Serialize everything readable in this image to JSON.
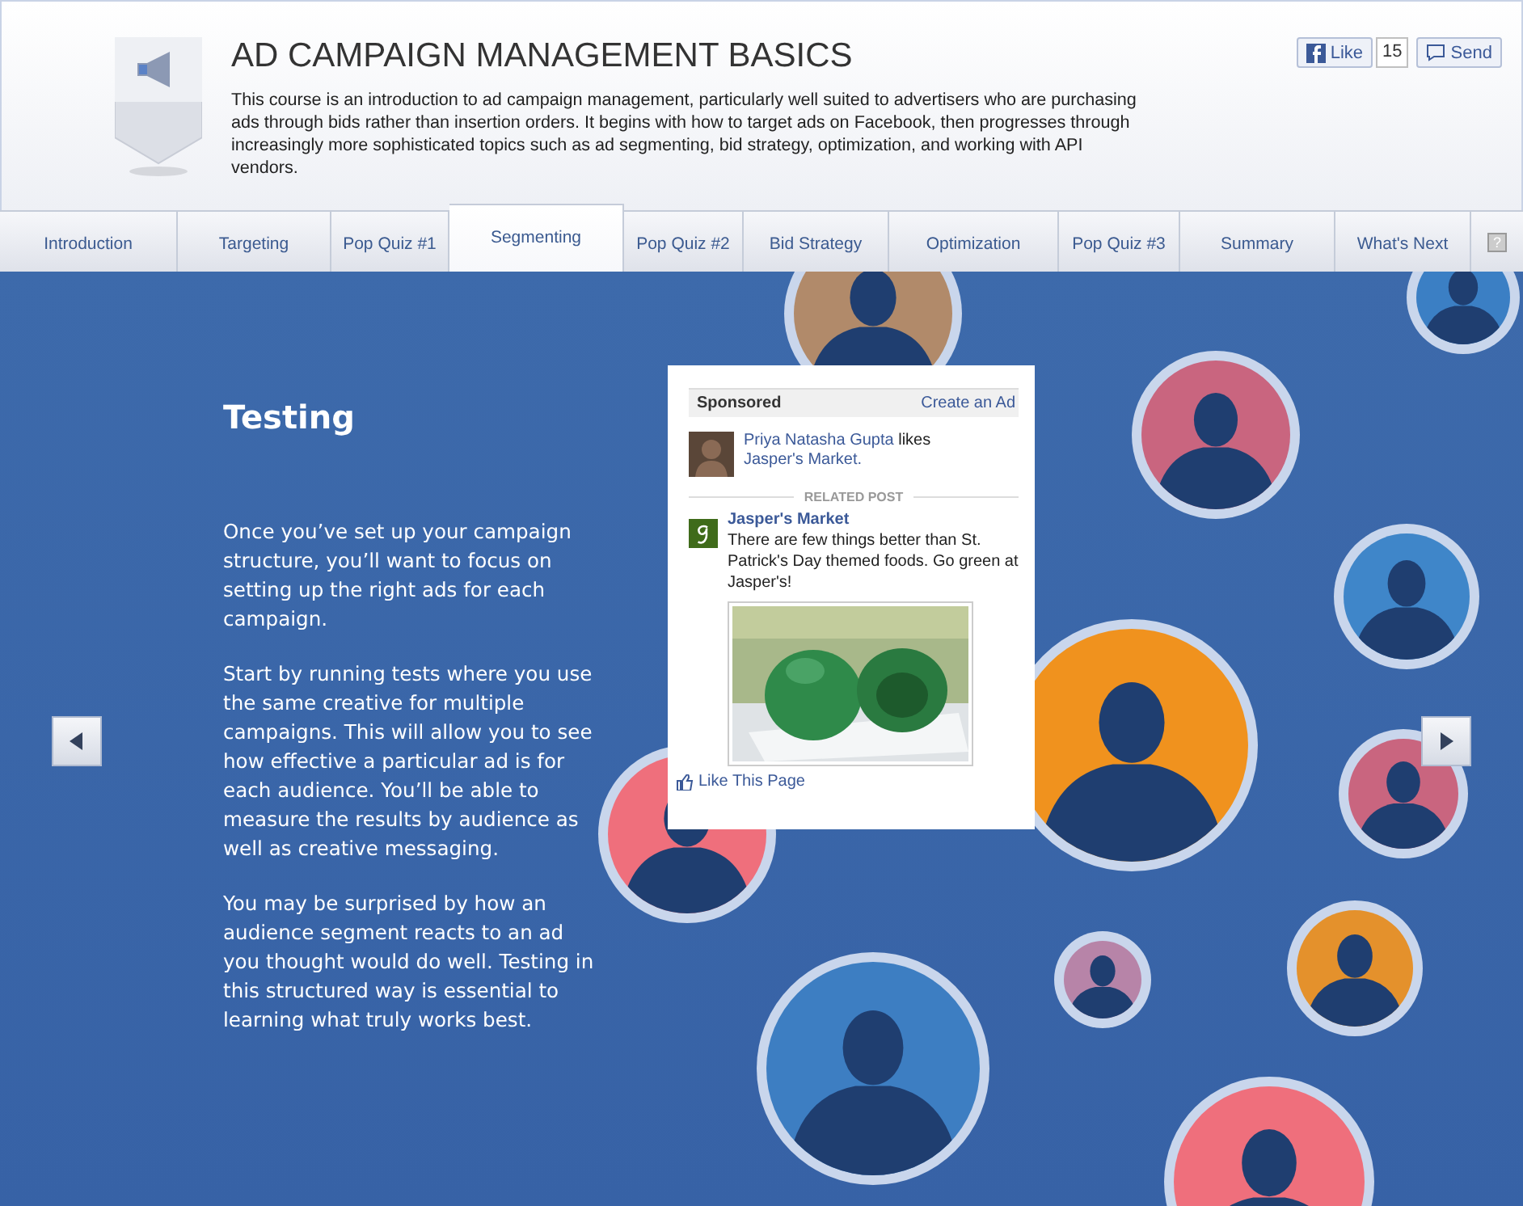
{
  "header": {
    "title": "AD CAMPAIGN MANAGEMENT BASICS",
    "description": "This course is an introduction to ad campaign management, particularly well suited to advertisers who are purchasing ads through bids rather than insertion orders. It begins with how to target ads on Facebook, then progresses through increasingly more sophisticated topics such as ad segmenting, bid strategy, optimization, and working with API vendors."
  },
  "social": {
    "like_label": "Like",
    "like_count": "15",
    "send_label": "Send"
  },
  "tabs": [
    {
      "label": "Introduction",
      "selected": false
    },
    {
      "label": "Targeting",
      "selected": false
    },
    {
      "label": "Pop Quiz #1",
      "selected": false
    },
    {
      "label": "Segmenting",
      "selected": true
    },
    {
      "label": "Pop Quiz #2",
      "selected": false
    },
    {
      "label": "Bid Strategy",
      "selected": false
    },
    {
      "label": "Optimization",
      "selected": false
    },
    {
      "label": "Pop Quiz #3",
      "selected": false
    },
    {
      "label": "Summary",
      "selected": false
    },
    {
      "label": "What's Next",
      "selected": false
    }
  ],
  "help_label": "?",
  "content": {
    "title": "Testing",
    "paragraphs": [
      "Once you’ve set up your campaign structure, you’ll want to focus on setting up the right ads for each campaign.",
      "Start by running tests where you use the same creative for multiple campaigns. This will allow you to see how effective a particular ad is for each audience. You’ll be able to measure the results by audience as well as creative messaging.",
      "You may be surprised by how an audience segment reacts to an ad you thought would do well. Testing in this structured way is essential to learning what truly works best."
    ]
  },
  "ad": {
    "header_label": "Sponsored",
    "create_link": "Create an Ad",
    "liker_name": "Priya Natasha Gupta",
    "liker_action": "likes",
    "liked_page": "Jasper's Market.",
    "related_label": "RELATED POST",
    "page_name": "Jasper's Market",
    "post_text": "There are few things better than St. Patrick's Day themed foods. Go green at Jasper's!",
    "like_page_label": "Like This Page"
  }
}
